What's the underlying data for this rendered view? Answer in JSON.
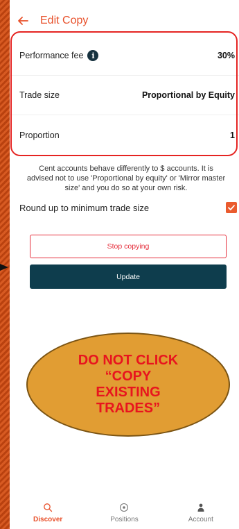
{
  "header": {
    "title": "Edit Copy"
  },
  "settings": [
    {
      "label": "Performance fee",
      "value": "30%",
      "has_info": true
    },
    {
      "label": "Trade size",
      "value": "Proportional by Equity",
      "has_info": false
    },
    {
      "label": "Proportion",
      "value": "1",
      "has_info": false
    }
  ],
  "notice": "Cent accounts behave differently to $ accounts. It is advised not to use 'Proportional by equity' or 'Mirror master size' and you do so at your own risk.",
  "roundup": {
    "label": "Round up to minimum trade size",
    "checked": true
  },
  "buttons": {
    "stop_label": "Stop copying",
    "update_label": "Update"
  },
  "overlay": {
    "warning_text": "DO NOT CLICK\n“COPY\nEXISTING\nTRADES”"
  },
  "bottom_nav": [
    {
      "label": "Discover",
      "icon": "search-icon",
      "active": true
    },
    {
      "label": "Positions",
      "icon": "target-icon",
      "active": false
    },
    {
      "label": "Account",
      "icon": "user-icon",
      "active": false
    }
  ],
  "colors": {
    "accent": "#e8502a",
    "primary_button": "#0e3d4d",
    "danger": "#e52d3a",
    "outline": "#e52422",
    "warning_fill": "#e19d33",
    "warning_text": "#e8141e"
  }
}
